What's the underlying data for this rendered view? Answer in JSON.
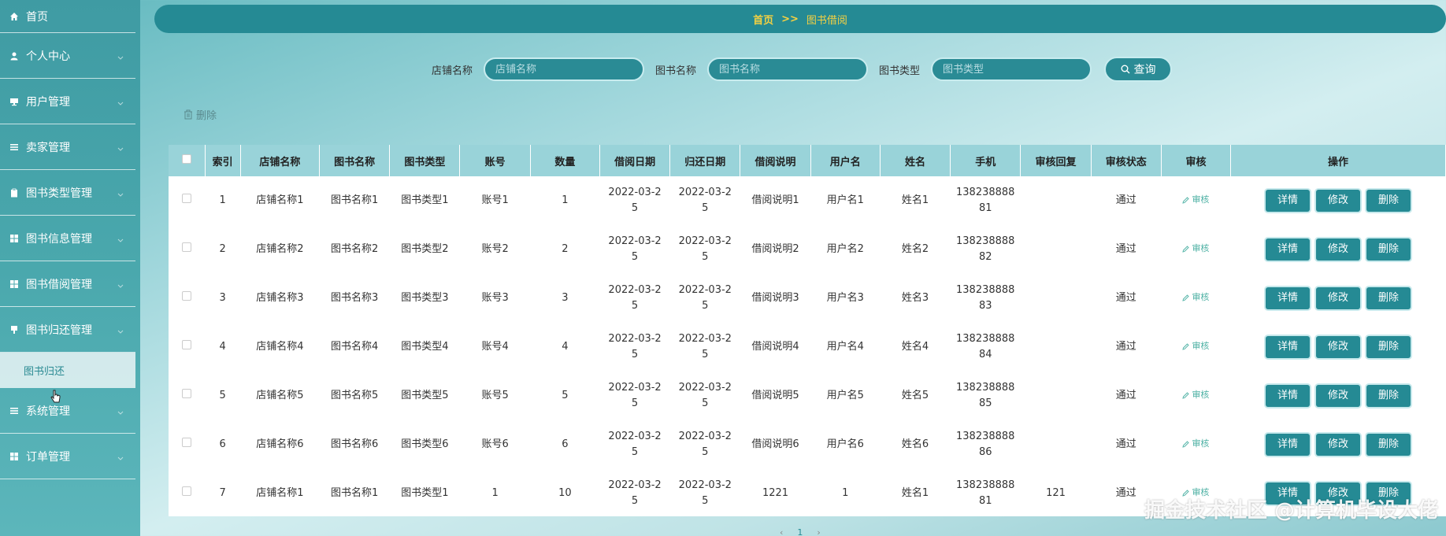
{
  "sidebar": {
    "home": "首页",
    "items": [
      {
        "label": "个人中心"
      },
      {
        "label": "用户管理"
      },
      {
        "label": "卖家管理"
      },
      {
        "label": "图书类型管理"
      },
      {
        "label": "图书信息管理"
      },
      {
        "label": "图书借阅管理"
      },
      {
        "label": "图书归还管理"
      }
    ],
    "sub_item": "图书归还",
    "items_after": [
      {
        "label": "系统管理"
      },
      {
        "label": "订单管理"
      }
    ]
  },
  "breadcrumb": {
    "home": "首页",
    "sep": ">>",
    "current": "图书借阅"
  },
  "search": {
    "shop_label": "店铺名称",
    "shop_placeholder": "店铺名称",
    "book_label": "图书名称",
    "book_placeholder": "图书名称",
    "type_label": "图书类型",
    "type_placeholder": "图书类型",
    "query_button": "查询"
  },
  "toolbar": {
    "delete_label": "删除"
  },
  "table": {
    "columns": [
      "索引",
      "店铺名称",
      "图书名称",
      "图书类型",
      "账号",
      "数量",
      "借阅日期",
      "归还日期",
      "借阅说明",
      "用户名",
      "姓名",
      "手机",
      "审核回复",
      "审核状态",
      "审核",
      "操作"
    ],
    "rows": [
      [
        "1",
        "店铺名称1",
        "图书名称1",
        "图书类型1",
        "账号1",
        "1",
        "2022-03-2\n5",
        "2022-03-2\n5",
        "借阅说明1",
        "用户名1",
        "姓名1",
        "138238888\n81",
        "",
        "通过"
      ],
      [
        "2",
        "店铺名称2",
        "图书名称2",
        "图书类型2",
        "账号2",
        "2",
        "2022-03-2\n5",
        "2022-03-2\n5",
        "借阅说明2",
        "用户名2",
        "姓名2",
        "138238888\n82",
        "",
        "通过"
      ],
      [
        "3",
        "店铺名称3",
        "图书名称3",
        "图书类型3",
        "账号3",
        "3",
        "2022-03-2\n5",
        "2022-03-2\n5",
        "借阅说明3",
        "用户名3",
        "姓名3",
        "138238888\n83",
        "",
        "通过"
      ],
      [
        "4",
        "店铺名称4",
        "图书名称4",
        "图书类型4",
        "账号4",
        "4",
        "2022-03-2\n5",
        "2022-03-2\n5",
        "借阅说明4",
        "用户名4",
        "姓名4",
        "138238888\n84",
        "",
        "通过"
      ],
      [
        "5",
        "店铺名称5",
        "图书名称5",
        "图书类型5",
        "账号5",
        "5",
        "2022-03-2\n5",
        "2022-03-2\n5",
        "借阅说明5",
        "用户名5",
        "姓名5",
        "138238888\n85",
        "",
        "通过"
      ],
      [
        "6",
        "店铺名称6",
        "图书名称6",
        "图书类型6",
        "账号6",
        "6",
        "2022-03-2\n5",
        "2022-03-2\n5",
        "借阅说明6",
        "用户名6",
        "姓名6",
        "138238888\n86",
        "",
        "通过"
      ],
      [
        "7",
        "店铺名称1",
        "图书名称1",
        "图书类型1",
        "1",
        "10",
        "2022-03-2\n5",
        "2022-03-2\n5",
        "1221",
        "1",
        "姓名1",
        "138238888\n81",
        "121",
        "通过"
      ]
    ],
    "audit_label": "审核",
    "op_detail": "详情",
    "op_edit": "修改",
    "op_delete": "删除"
  },
  "pager": {
    "prev": "‹",
    "page": "1",
    "next": "›"
  },
  "watermark": "掘金技术社区 @计算机毕设大佬",
  "colors": {
    "accent": "#258a94",
    "breadcrumb": "#f5d142",
    "header_row": "#99d3d9"
  }
}
